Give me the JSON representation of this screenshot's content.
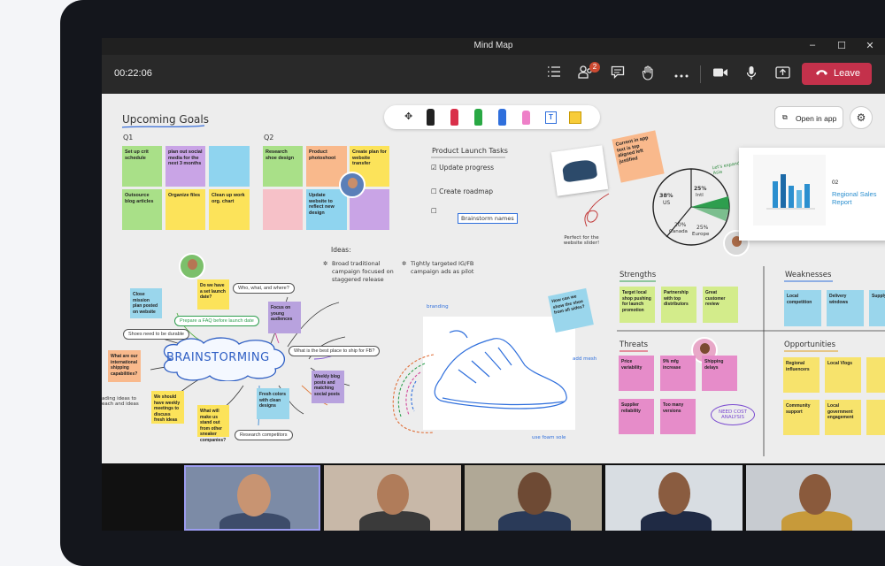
{
  "window": {
    "title": "Mind Map",
    "controls": {
      "minimize": "–",
      "maximize": "☐",
      "close": "✕"
    }
  },
  "toolbar": {
    "timer": "00:22:06",
    "participants_badge": "2",
    "leave_label": "Leave"
  },
  "board": {
    "open_in_app": "Open in app",
    "upcoming_goals": "Upcoming Goals",
    "q1": "Q1",
    "q2": "Q2",
    "q1_notes": [
      "Set up crit schedule",
      "plan out social media for the next 3 months",
      "",
      "Outsource blog articles",
      "Organize files",
      "Clean up work org. chart"
    ],
    "q2_notes": [
      "Research shoe design",
      "Product photoshoot",
      "Create plan for website transfer",
      "",
      "Update website to reflect new design",
      ""
    ],
    "tasks": {
      "title": "Product Launch Tasks",
      "items": [
        "Update progress",
        "Create roadmap"
      ],
      "brainstorm": "Brainstorm names"
    },
    "current_note": "Current in app text is top aligned left justified",
    "pie_labels": {
      "p38": "38%",
      "us": "US",
      "p25a": "25%",
      "intl": "Intl",
      "p20": "20%",
      "canada": "Canada",
      "p25b": "25%",
      "europe": "Europe",
      "lets_expand": "Let's expand in Asia"
    },
    "perfect_note": "Perfect for the website slider!",
    "report": {
      "num": "02",
      "title": "Regional Sales Report"
    },
    "ideas": {
      "title": "Ideas:",
      "idea1": "Broad traditional campaign focused on staggered release",
      "idea2": "Tightly targeted IG/FB campaign ads as pilot"
    },
    "brainstorming": "BRAINSTORMING",
    "mind_notes": {
      "n1": "Close mission plan posted on website",
      "n2": "Do we have a set launch date?",
      "n3": "What are our international shipping capabilities?",
      "n4": "We should have weekly meetings to discuss fresh ideas",
      "n5": "What will make us stand out from other sneaker companies?",
      "n6": "Fresh colors with clean designs",
      "n7": "Weekly blog posts and matching social posts",
      "n8": "Focus on young audiences",
      "n9": "Prepare a FAQ before launch date"
    },
    "mind_pills": {
      "p1": "Who, what, and where?",
      "p2": "Shoes need to be durable",
      "p3": "What is the best place to ship for FB?",
      "p4": "Research competitors",
      "p5": "ading ideas to each and ideas"
    },
    "sneaker_notes": {
      "how": "How can we show the shoe from all sides?",
      "branding": "branding",
      "add_mesh": "add mesh",
      "use_foam": "use foam sole"
    },
    "swot": {
      "strengths": "Strengths",
      "weaknesses": "Weaknesses",
      "threats": "Threats",
      "opportunities": "Opportunities",
      "strength_notes": [
        "Target local shop pushing for launch promotion",
        "Partnership with top distributors",
        "Great customer review"
      ],
      "weakness_notes": [
        "Local competition",
        "Delivery windows",
        "Supply"
      ],
      "threat_notes": [
        "Price variability",
        "9% mfg increase",
        "Shipping delays",
        "Supplier reliability",
        "Too many versions"
      ],
      "need_cost": "NEED COST ANALYSIS",
      "opp_notes": [
        "Regional influencers",
        "Local Vlogs",
        "",
        "Community support",
        "Local government engagement",
        ""
      ]
    }
  },
  "colors": {
    "leave": "#c4314b",
    "titlebar": "#202020",
    "toolbar": "#292929",
    "board": "#ededed",
    "frame": "#14161c"
  },
  "icons": [
    "list-icon",
    "people-icon",
    "chat-icon",
    "raise-hand-icon",
    "more-icon",
    "camera-icon",
    "mic-icon",
    "share-icon",
    "phone-icon"
  ]
}
